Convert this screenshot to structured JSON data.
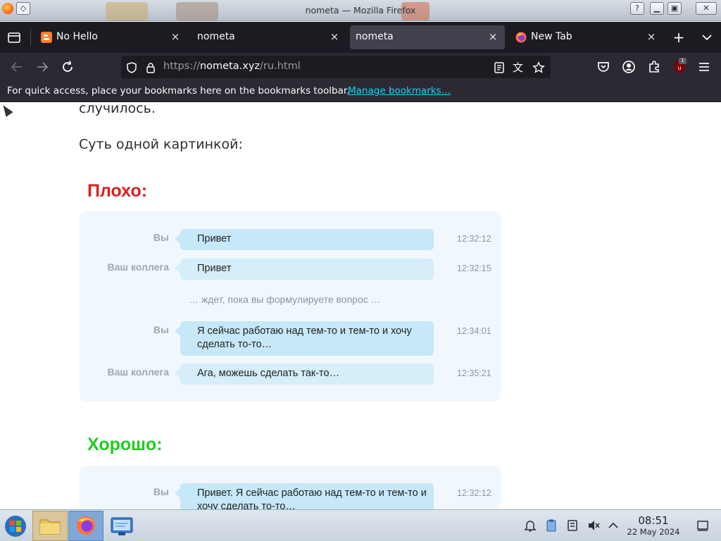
{
  "window": {
    "title": "nometa — Mozilla Firefox",
    "title_button_help": "?"
  },
  "tabs": [
    {
      "label": "No Hello",
      "favicon": "blogger-icon",
      "active": false
    },
    {
      "label": "nometa",
      "favicon": null,
      "active": false
    },
    {
      "label": "nometa",
      "favicon": null,
      "active": true
    },
    {
      "label": "New Tab",
      "favicon": "firefox-icon",
      "active": false
    }
  ],
  "tab_close_glyph": "×",
  "new_tab_glyph": "+",
  "navbar": {
    "url_prefix": "https://",
    "url_host": "nometa.xyz",
    "url_path": "/ru.html",
    "extension_badge": "1"
  },
  "bookmarks_bar": {
    "message": "For quick access, place your bookmarks here on the bookmarks toolbar.",
    "link": "Manage bookmarks…"
  },
  "page": {
    "intro_tail": "случилось.",
    "summary": "Суть одной картинкой:",
    "bad_heading": "Плохо:",
    "good_heading": "Хорошо:",
    "bad_chat": {
      "rows": [
        {
          "sender": "Вы",
          "text": "Привет",
          "time": "12:32:12"
        },
        {
          "sender": "Ваш коллега",
          "text": "Привет",
          "time": "12:32:15"
        },
        {
          "sender": "Вы",
          "text": "Я сейчас работаю над тем-то и тем-то и хочу сделать то-то…",
          "time": "12:34:01"
        },
        {
          "sender": "Ваш коллега",
          "text": "Ага, можешь сделать так-то…",
          "time": "12:35:21"
        }
      ],
      "waiting": "… ждет, пока вы формулируете вопрос …"
    },
    "good_chat": {
      "rows": [
        {
          "sender": "Вы",
          "text": "Привет. Я сейчас работаю над тем-то и тем-то и хочу сделать то-то…",
          "time": "12:32:12"
        }
      ]
    }
  },
  "taskbar": {
    "clock_time": "08:51",
    "clock_date": "22 May 2024"
  },
  "colors": {
    "bad_heading": "#d62123",
    "good_heading": "#22cc22",
    "chat_bg": "#f1f8fd",
    "bubble": "#c6e8f8"
  }
}
